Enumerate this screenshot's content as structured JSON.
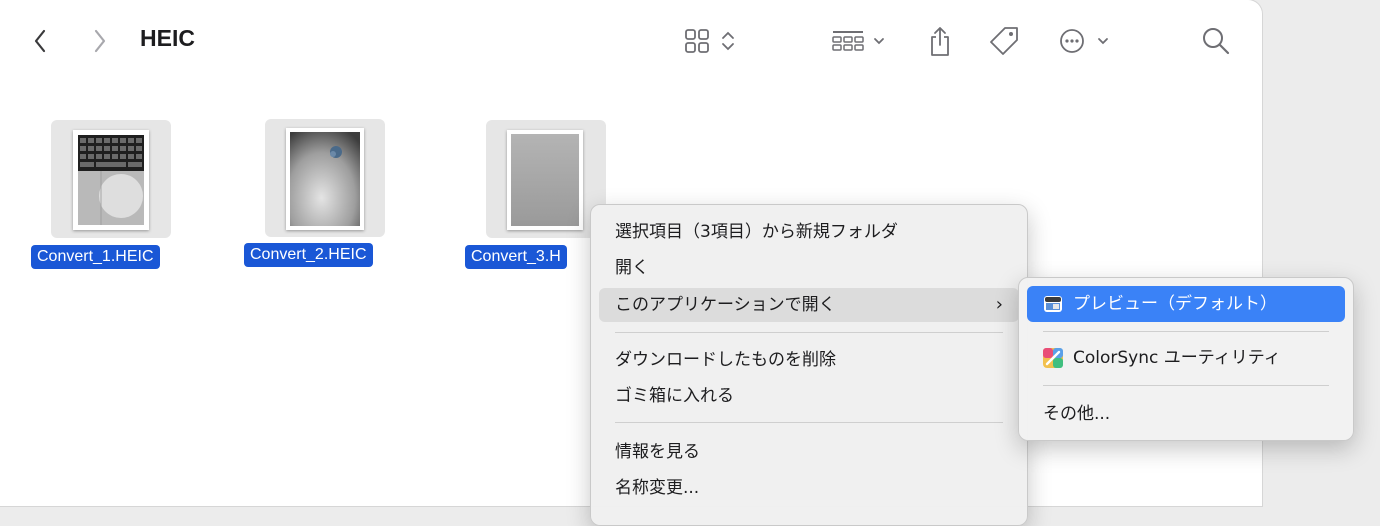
{
  "toolbar": {
    "title": "HEIC",
    "icons": [
      "back-chevron-icon",
      "forward-chevron-icon",
      "icon-view-icon",
      "group-icon",
      "share-icon",
      "tag-icon",
      "more-icon",
      "search-icon"
    ]
  },
  "files": [
    {
      "name": "Convert_1.HEIC"
    },
    {
      "name": "Convert_2.HEIC"
    },
    {
      "name": "Convert_3.H"
    }
  ],
  "context_menu": {
    "items": [
      "選択項目（3項目）から新規フォルダ",
      "開く",
      "このアプリケーションで開く",
      "ダウンロードしたものを削除",
      "ゴミ箱に入れる",
      "情報を見る",
      "名称変更..."
    ],
    "submenu_arrow": "›"
  },
  "submenu": {
    "items": [
      "プレビュー（デフォルト）",
      "ColorSync ユーティリティ",
      "その他..."
    ]
  },
  "colors": {
    "selection": "#1a57d6",
    "menu_highlight": "#3a82f7"
  }
}
